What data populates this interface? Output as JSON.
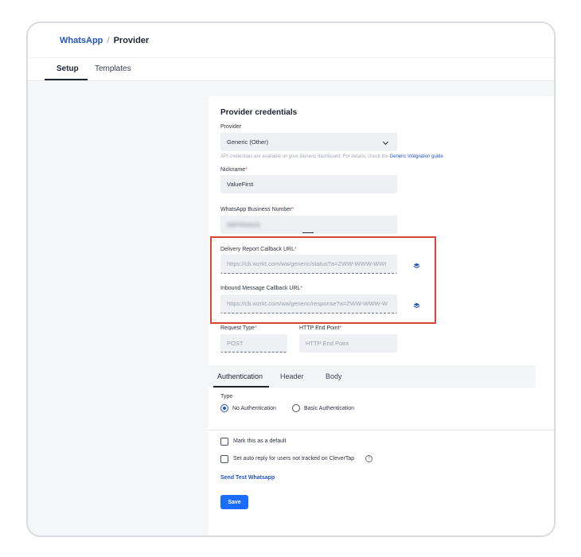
{
  "breadcrumb": {
    "parent": "WhatsApp",
    "separator": "/",
    "current": "Provider"
  },
  "tabs": [
    {
      "label": "Setup",
      "active": true
    },
    {
      "label": "Templates",
      "active": false
    }
  ],
  "panel": {
    "title": "Provider credentials",
    "provider": {
      "label": "Provider",
      "value": "Generic (Other)"
    },
    "helper": {
      "text": "API credentials are available on your Generic dashboard. For details, check the",
      "link": "Generic Integration guide"
    },
    "nickname": {
      "label": "Nickname",
      "value": "ValueFirst"
    },
    "business_number": {
      "label": "WhatsApp Business Number",
      "value": "9987654416"
    },
    "delivery_callback": {
      "label": "Delivery Report Callback URL",
      "value": "https://cb.wzrkt.com/wa/generic/status?a=ZWW-WWW-WWI"
    },
    "inbound_callback": {
      "label": "Inbound Message Callback URL",
      "value": "https://cb.wzrkt.com/wa/generic/response?a=ZWW-WWW-W"
    },
    "request_type": {
      "label": "Request Type",
      "value": "POST"
    },
    "http_end_point": {
      "label": "HTTP End Point",
      "placeholder": "HTTP End Point"
    },
    "required_mark": "*"
  },
  "subtabs": [
    {
      "label": "Authentication",
      "active": true
    },
    {
      "label": "Header",
      "active": false
    },
    {
      "label": "Body",
      "active": false
    }
  ],
  "auth": {
    "type_label": "Type",
    "options": [
      "No Authentication",
      "Basic Authentication"
    ],
    "selected": "No Authentication"
  },
  "options": {
    "default_label": "Mark this as a default",
    "auto_reply_label": "Set auto reply for users not tracked on CleverTap",
    "help_glyph": "?"
  },
  "send_test_link": "Send Test Whatsapp",
  "save_button": "Save",
  "colors": {
    "accent": "#1a6dfc",
    "link": "#2453c4",
    "highlight_box": "#d9453a",
    "required": "#e0483f"
  },
  "icons": {
    "dropdown": "chevron-down-icon",
    "copy": "copy-icon",
    "help": "question-icon"
  }
}
